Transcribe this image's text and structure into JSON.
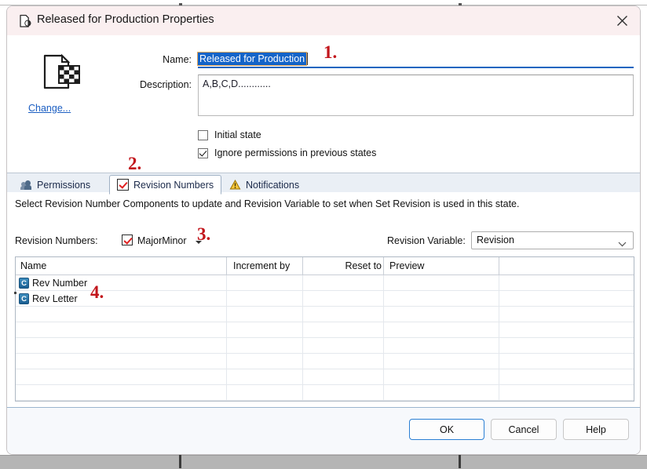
{
  "window": {
    "title": "Released for Production Properties",
    "title_icon": "state-document-icon",
    "close_icon": "close-icon"
  },
  "state_icon": {
    "name": "released-state-document-icon",
    "change_link": "Change..."
  },
  "form": {
    "name_label": "Name:",
    "name_value": "Released for Production",
    "description_label": "Description:",
    "description_value": "A,B,C,D............",
    "checkboxes": [
      {
        "label": "Initial state",
        "checked": false
      },
      {
        "label": "Ignore permissions in previous states",
        "checked": true
      }
    ]
  },
  "tabs": [
    {
      "label": "Permissions",
      "icon": "users-icon",
      "active": false
    },
    {
      "label": "Revision Numbers",
      "icon": "red-check-icon",
      "active": true
    },
    {
      "label": "Notifications",
      "icon": "bell-warning-icon",
      "active": false
    }
  ],
  "revision_panel": {
    "instruction": "Select Revision Number Components to update and Revision Variable to set when Set Revision is used in this state.",
    "revision_numbers_label": "Revision Numbers:",
    "revision_numbers_value": "MajorMinor",
    "revision_numbers_checked": true,
    "dropdown_icon": "chevron-down-icon",
    "revision_variable_label": "Revision Variable:",
    "revision_variable_value": "Revision",
    "revision_variable_chevron": "chevron-down-icon"
  },
  "grid": {
    "columns": [
      "Name",
      "Increment by",
      "Reset to",
      "Preview",
      ""
    ],
    "rows": [
      {
        "icon": "component-icon",
        "icon_letter": "C",
        "name": "Rev Number",
        "increment_by": "",
        "reset_to": "",
        "preview": "",
        "extra": ""
      },
      {
        "icon": "component-icon",
        "icon_letter": "C",
        "name": "Rev Letter",
        "increment_by": "",
        "reset_to": "",
        "preview": "",
        "extra": ""
      }
    ],
    "empty_row_count": 7
  },
  "footer": {
    "ok_label": "OK",
    "cancel_label": "Cancel",
    "help_label": "Help"
  },
  "annotations": [
    {
      "id": "1",
      "text": "1."
    },
    {
      "id": "2",
      "text": "2."
    },
    {
      "id": "3",
      "text": "3."
    },
    {
      "id": "4",
      "text": "4."
    }
  ],
  "colors": {
    "titlebar": "#faeff0",
    "accent_blue": "#1464c8",
    "link_blue": "#1b5ec2",
    "annotation_red": "#c2161c",
    "tabstrip": "#eaeff5",
    "focus_blue": "#2a7fd4"
  }
}
